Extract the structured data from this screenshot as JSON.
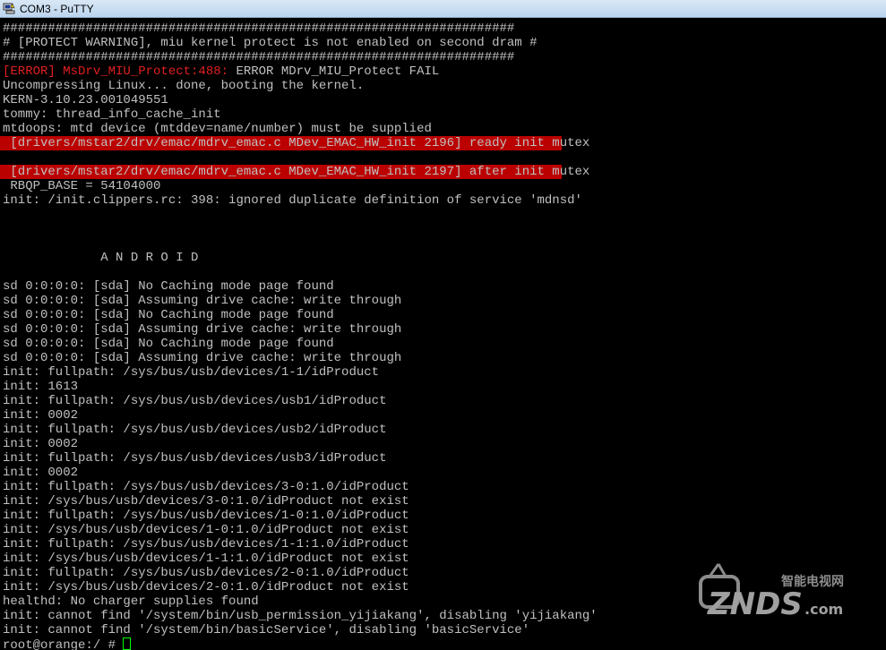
{
  "window": {
    "title": "COM3 - PuTTY",
    "icon": "putty-icon"
  },
  "terminal": {
    "lines": [
      "####################################################################",
      "# [PROTECT WARNING], miu kernel protect is not enabled on second dram #",
      "####################################################################",
      "",
      "Uncompressing Linux... done, booting the kernel.",
      "KERN-3.10.23.001049551",
      "tommy: thread_info_cache_init",
      "mtdoops: mtd device (mtddev=name/number) must be supplied",
      " [drivers/mstar2/drv/emac/mdrv_emac.c MDev_EMAC_HW_init 2196] ready init mutex",
      "",
      " [drivers/mstar2/drv/emac/mdrv_emac.c MDev_EMAC_HW_init 2197] after init mutex",
      " RBQP_BASE = 54104000",
      "init: /init.clippers.rc: 398: ignored duplicate definition of service 'mdnsd'",
      "",
      "",
      "",
      "             A N D R O I D",
      "",
      "sd 0:0:0:0: [sda] No Caching mode page found",
      "sd 0:0:0:0: [sda] Assuming drive cache: write through",
      "sd 0:0:0:0: [sda] No Caching mode page found",
      "sd 0:0:0:0: [sda] Assuming drive cache: write through",
      "sd 0:0:0:0: [sda] No Caching mode page found",
      "sd 0:0:0:0: [sda] Assuming drive cache: write through",
      "init: fullpath: /sys/bus/usb/devices/1-1/idProduct",
      "init: 1613",
      "init: fullpath: /sys/bus/usb/devices/usb1/idProduct",
      "init: 0002",
      "init: fullpath: /sys/bus/usb/devices/usb2/idProduct",
      "init: 0002",
      "init: fullpath: /sys/bus/usb/devices/usb3/idProduct",
      "init: 0002",
      "init: fullpath: /sys/bus/usb/devices/3-0:1.0/idProduct",
      "init: /sys/bus/usb/devices/3-0:1.0/idProduct not exist",
      "init: fullpath: /sys/bus/usb/devices/1-0:1.0/idProduct",
      "init: /sys/bus/usb/devices/1-0:1.0/idProduct not exist",
      "init: fullpath: /sys/bus/usb/devices/1-1:1.0/idProduct",
      "init: /sys/bus/usb/devices/1-1:1.0/idProduct not exist",
      "init: fullpath: /sys/bus/usb/devices/2-0:1.0/idProduct",
      "init: /sys/bus/usb/devices/2-0:1.0/idProduct not exist",
      "healthd: No charger supplies found",
      "init: cannot find '/system/bin/usb_permission_yijiakang', disabling 'yijiakang'",
      "init: cannot find '/system/bin/basicService', disabling 'basicService'"
    ],
    "error_line": {
      "prefix": "[ERROR] MsDrv_MIU_Protect:488:",
      "message": " ERROR MDrv_MIU_Protect FAIL"
    },
    "prompt": "root@orange:/ # "
  },
  "watermark": {
    "brand": "ZNDS",
    "suffix": ".com",
    "tagline": "智能电视网"
  },
  "colors": {
    "text": "#c0c0c0",
    "error": "#e02020",
    "highlight_bg": "#bb0000",
    "cursor": "#00ff00",
    "background": "#000000"
  }
}
